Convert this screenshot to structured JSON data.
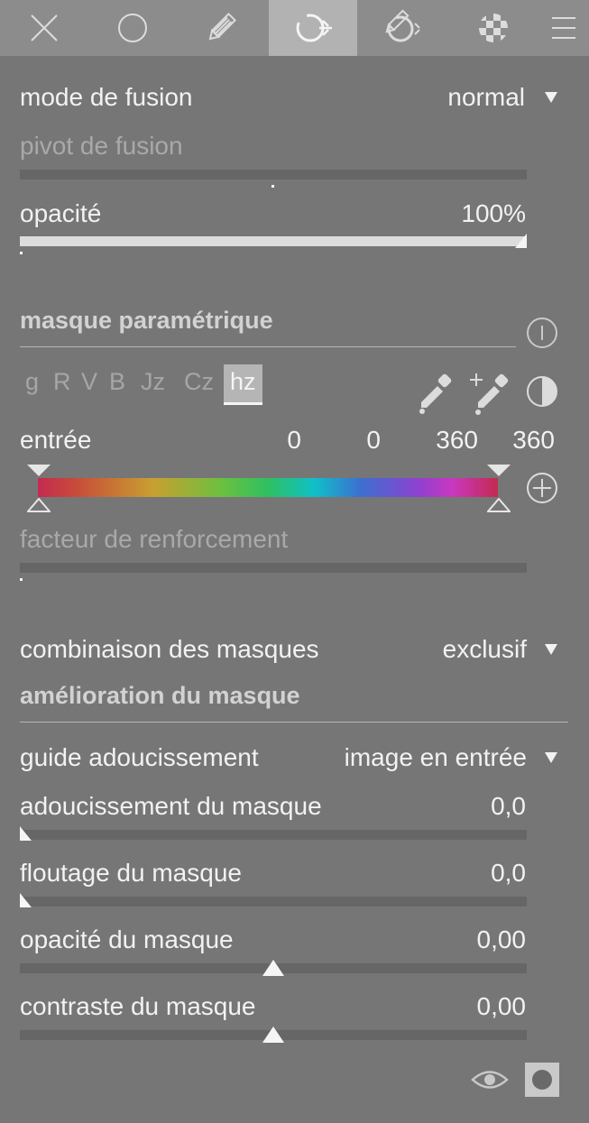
{
  "tabs": [
    {
      "name": "close-icon"
    },
    {
      "name": "circle-icon"
    },
    {
      "name": "pencil-icon"
    },
    {
      "name": "parametric-mask-icon",
      "active": true
    },
    {
      "name": "drawn-parametric-mask-icon"
    },
    {
      "name": "raster-mask-icon"
    },
    {
      "name": "hamburger-menu-icon"
    }
  ],
  "blend": {
    "mode_label": "mode de fusion",
    "mode_value": "normal",
    "pivot_label": "pivot de fusion",
    "opacity_label": "opacité",
    "opacity_value": "100%",
    "opacity_fraction": 1.0
  },
  "parametric": {
    "title": "masque paramétrique",
    "channels": [
      "g",
      "R",
      "V",
      "B",
      "Jz",
      "Cz",
      "hz"
    ],
    "active_channel": "hz",
    "input_label": "entrée",
    "input_values": [
      "0",
      "0",
      "360",
      "360"
    ],
    "boost_label": "facteur de renforcement"
  },
  "combine": {
    "label": "combinaison des masques",
    "value": "exclusif"
  },
  "refine": {
    "title": "amélioration du masque",
    "guide_label": "guide adoucissement",
    "guide_value": "image en entrée",
    "sliders": [
      {
        "label": "adoucissement du masque",
        "value": "0,0"
      },
      {
        "label": "floutage du masque",
        "value": "0,0"
      },
      {
        "label": "opacité du masque",
        "value": "0,00"
      },
      {
        "label": "contraste du masque",
        "value": "0,00"
      }
    ]
  },
  "footer": {
    "icons": [
      "eye-icon",
      "mask-display-icon"
    ]
  }
}
